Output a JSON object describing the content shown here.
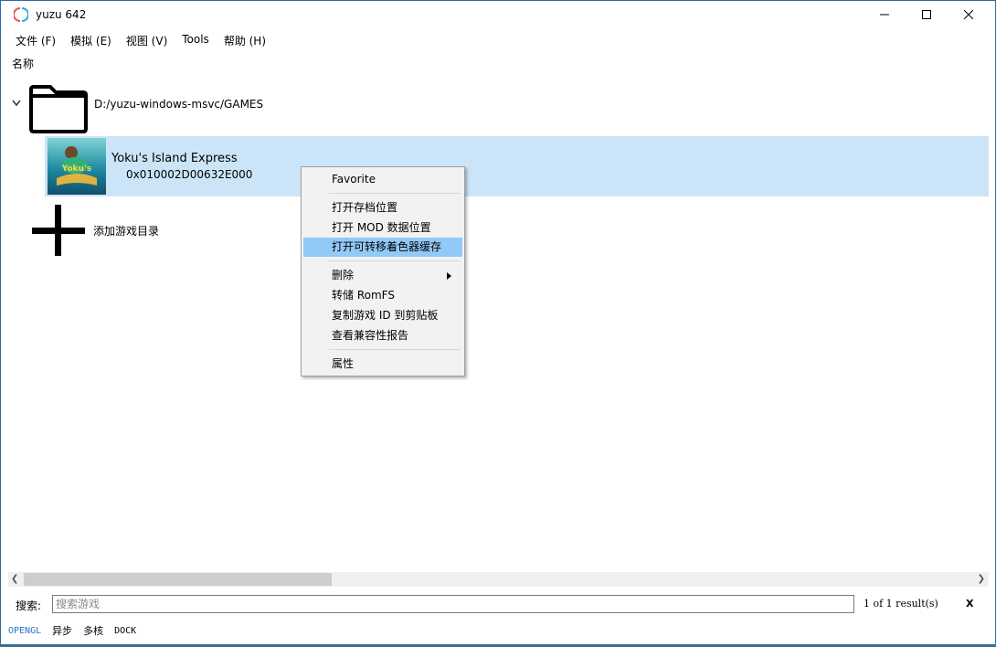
{
  "window": {
    "title": "yuzu 642"
  },
  "menu": [
    {
      "label": "文件 (F)"
    },
    {
      "label": "模拟 (E)"
    },
    {
      "label": "视图 (V)"
    },
    {
      "label": "Tools"
    },
    {
      "label": "帮助 (H)"
    }
  ],
  "list": {
    "column_header": "名称",
    "directory": {
      "path": "D:/yuzu-windows-msvc/GAMES"
    },
    "game": {
      "name": "Yoku's Island Express",
      "id": "0x010002D00632E000",
      "cover_text": "Yoku's"
    },
    "add_dir_label": "添加游戏目录"
  },
  "context_menu": {
    "items": [
      {
        "label": "Favorite"
      },
      {
        "label": "打开存档位置"
      },
      {
        "label": "打开 MOD 数据位置"
      },
      {
        "label": "打开可转移着色器缓存"
      },
      {
        "label": "删除"
      },
      {
        "label": "转储 RomFS"
      },
      {
        "label": "复制游戏 ID 到剪贴板"
      },
      {
        "label": "查看兼容性报告"
      },
      {
        "label": "属性"
      }
    ]
  },
  "search": {
    "label": "搜索:",
    "placeholder": "搜索游戏",
    "result_count": "1 of 1 result(s)",
    "clear_glyph": "X"
  },
  "status": {
    "renderer": "OPENGL",
    "async": "异步",
    "multicore": "多核",
    "dock": "DOCK"
  },
  "colors": {
    "selection": "#cce4f7",
    "menu_highlight": "#91c9f7",
    "accent": "#2a76c2"
  }
}
